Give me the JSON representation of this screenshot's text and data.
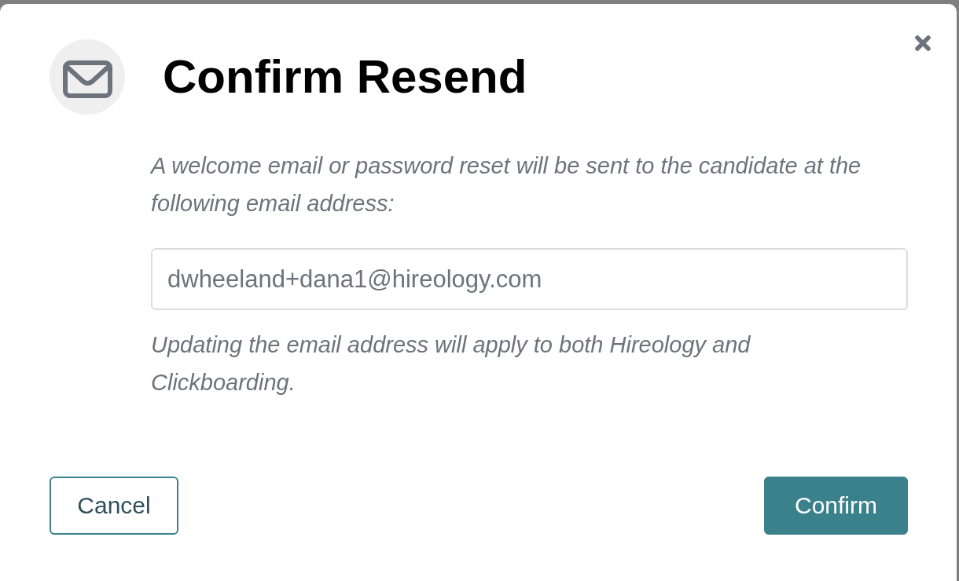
{
  "dialog": {
    "title": "Confirm Resend",
    "message": "A welcome email or password reset will be sent to the candidate at the following email address:",
    "email_field": {
      "value": "dwheeland+dana1@hireology.com"
    },
    "note": "Updating the email address will apply to both Hireology and Clickboarding.",
    "buttons": [
      {
        "label": "Cancel",
        "kind": "secondary"
      },
      {
        "label": "Confirm",
        "kind": "primary"
      }
    ]
  }
}
